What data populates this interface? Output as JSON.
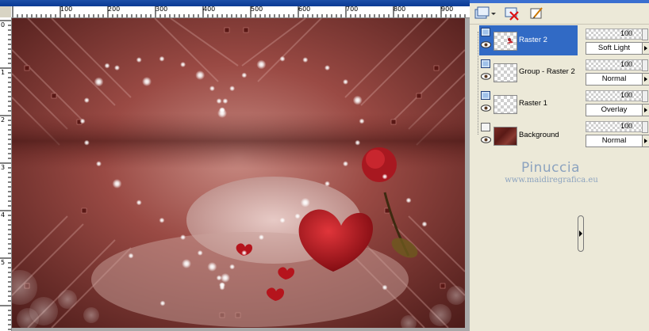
{
  "ruler": {
    "top_labels": [
      "100",
      "200",
      "300",
      "400",
      "500",
      "600",
      "700",
      "800",
      "900"
    ],
    "left_labels": [
      "0",
      "1",
      "2",
      "3",
      "4",
      "5"
    ]
  },
  "layers": [
    {
      "name": "Raster 2",
      "selected": true,
      "opacity": "100",
      "blend": "Soft Light"
    },
    {
      "name": "Group - Raster 2",
      "selected": false,
      "opacity": "100",
      "blend": "Normal"
    },
    {
      "name": "Raster 1",
      "selected": false,
      "opacity": "100",
      "blend": "Overlay"
    },
    {
      "name": "Background",
      "selected": false,
      "opacity": "100",
      "blend": "Normal"
    }
  ],
  "watermark": {
    "name": "Pinuccia",
    "url": "www.maidiregrafica.eu"
  },
  "colors": {
    "selection": "#316ac5",
    "panel": "#ece9d8",
    "canvas_bg": "#a9a9a9"
  },
  "icons": [
    "new-layer-icon",
    "delete-layer-icon",
    "edit-layer-icon",
    "eye-icon",
    "layer-type-icon",
    "expand-arrow-icon"
  ]
}
